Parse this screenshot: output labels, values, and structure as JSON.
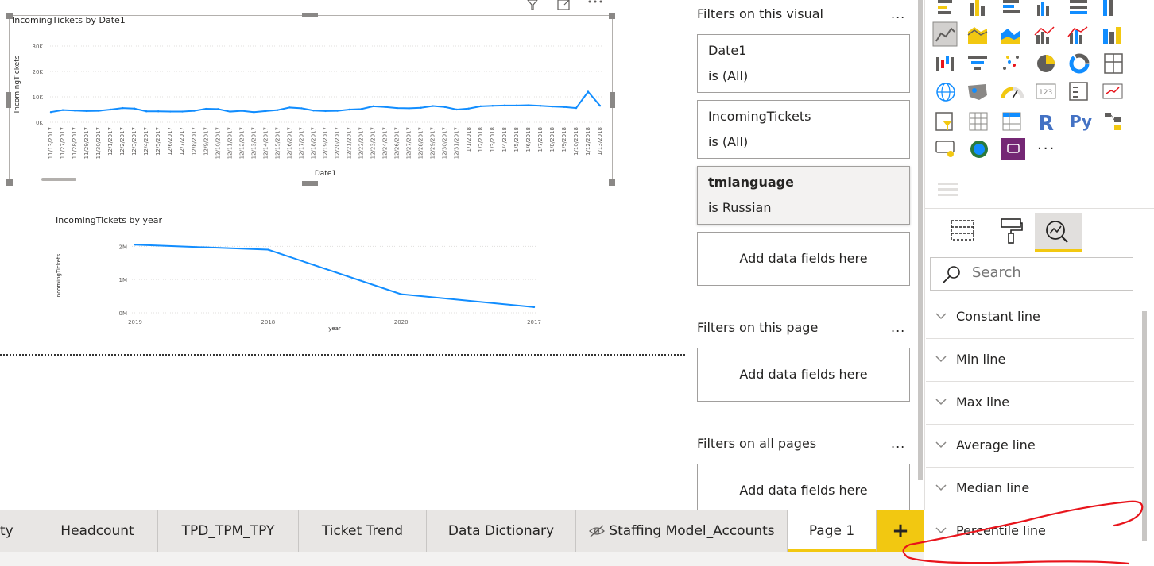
{
  "canvas": {
    "chart1": {
      "title": "IncomingTickets by Date1",
      "ylabel": "IncomingTickets",
      "xlabel": "Date1"
    },
    "chart2": {
      "title": "IncomingTickets by year",
      "ylabel": "IncomingTickets",
      "xlabel": "year"
    }
  },
  "chart_data": [
    {
      "type": "line",
      "title": "IncomingTickets by Date1",
      "xlabel": "Date1",
      "ylabel": "IncomingTickets",
      "ylim": [
        0,
        30000
      ],
      "yticks": [
        "0K",
        "10K",
        "20K",
        "30K"
      ],
      "x": [
        "11/13/2017",
        "11/27/2017",
        "11/28/2017",
        "11/29/2017",
        "11/30/2017",
        "12/1/2017",
        "12/2/2017",
        "12/3/2017",
        "12/4/2017",
        "12/5/2017",
        "12/6/2017",
        "12/7/2017",
        "12/8/2017",
        "12/9/2017",
        "12/10/2017",
        "12/11/2017",
        "12/12/2017",
        "12/13/2017",
        "12/14/2017",
        "12/15/2017",
        "12/16/2017",
        "12/17/2017",
        "12/18/2017",
        "12/19/2017",
        "12/20/2017",
        "12/21/2017",
        "12/22/2017",
        "12/23/2017",
        "12/24/2017",
        "12/26/2017",
        "12/27/2017",
        "12/28/2017",
        "12/29/2017",
        "12/30/2017",
        "12/31/2017",
        "1/1/2018",
        "1/2/2018",
        "1/3/2018",
        "1/4/2018",
        "1/5/2018",
        "1/6/2018",
        "1/7/2018",
        "1/8/2018",
        "1/9/2018",
        "1/10/2018",
        "1/12/2018",
        "1/13/2018"
      ],
      "values": [
        4000,
        4800,
        4600,
        4400,
        4500,
        5000,
        5600,
        5400,
        4300,
        4300,
        4200,
        4200,
        4500,
        5300,
        5200,
        4200,
        4500,
        4000,
        4400,
        4800,
        5800,
        5500,
        4600,
        4400,
        4500,
        5000,
        5200,
        6300,
        6000,
        5600,
        5500,
        5700,
        6400,
        6000,
        5000,
        5400,
        6300,
        6500,
        6600,
        6600,
        6700,
        6500,
        6200,
        6000,
        5600,
        12000,
        6500
      ]
    },
    {
      "type": "line",
      "title": "IncomingTickets by year",
      "xlabel": "year",
      "ylabel": "IncomingTickets",
      "ylim": [
        0,
        2200000
      ],
      "yticks": [
        "0M",
        "1M",
        "2M"
      ],
      "x": [
        "2019",
        "2018",
        "2020",
        "2017"
      ],
      "values": [
        2050000,
        1900000,
        560000,
        170000
      ]
    }
  ],
  "filters": {
    "visual_title": "Filters on this visual",
    "page_title": "Filters on this page",
    "all_title": "Filters on all pages",
    "more": "...",
    "cards": [
      {
        "name": "Date1",
        "value": "is (All)"
      },
      {
        "name": "IncomingTickets",
        "value": "is (All)"
      },
      {
        "name": "tmlanguage",
        "value": "is Russian"
      }
    ],
    "add_label": "Add data fields here"
  },
  "viz": {
    "more": "...",
    "search_placeholder": "Search",
    "analytics": [
      "Constant line",
      "Min line",
      "Max line",
      "Average line",
      "Median line",
      "Percentile line"
    ],
    "accent": "#f2c811"
  },
  "tabs": {
    "items": [
      "ty",
      "Headcount",
      "TPD_TPM_TPY",
      "Ticket Trend",
      "Data Dictionary",
      "Staffing Model_Accounts",
      "Page 1"
    ],
    "add": "+"
  },
  "colors": {
    "line": "#118dff",
    "annotation": "#e8141b",
    "accent": "#f2c811"
  }
}
